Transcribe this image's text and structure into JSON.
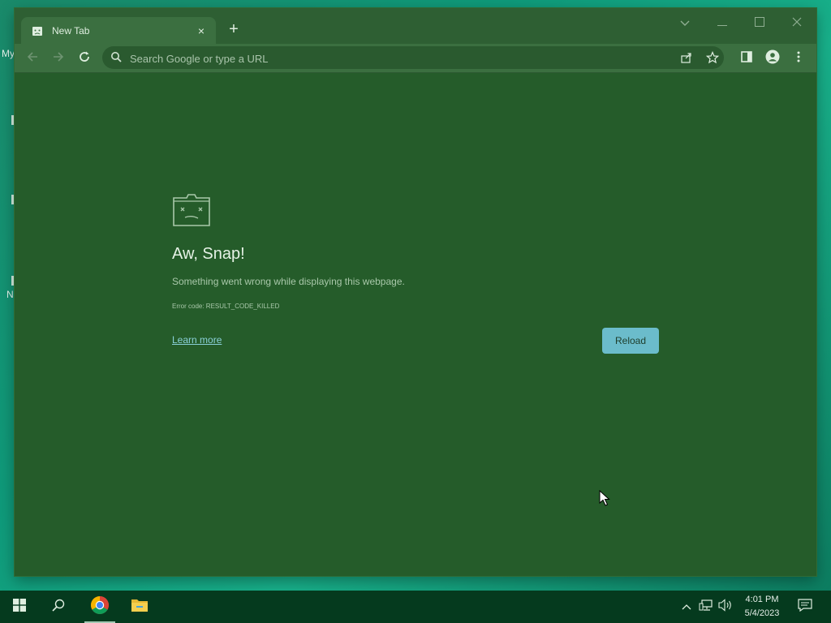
{
  "desktop": {
    "frag_top": "My",
    "frag_bottom": "N"
  },
  "browser": {
    "tab": {
      "title": "New Tab",
      "close_label": "×"
    },
    "new_tab_label": "+",
    "omnibox": {
      "placeholder": "Search Google or type a URL"
    }
  },
  "error_page": {
    "title": "Aw, Snap!",
    "description": "Something went wrong while displaying this webpage.",
    "error_code": "Error code: RESULT_CODE_KILLED",
    "learn_more": "Learn more",
    "reload": "Reload"
  },
  "taskbar": {
    "time": "4:01 PM",
    "date": "5/4/2023"
  },
  "colors": {
    "window_bg": "#255c2a",
    "toolbar_bg": "#3b6f40",
    "reload_button": "#6bbccb",
    "link": "#8ad0d8",
    "taskbar_bg": "#053a1e"
  }
}
